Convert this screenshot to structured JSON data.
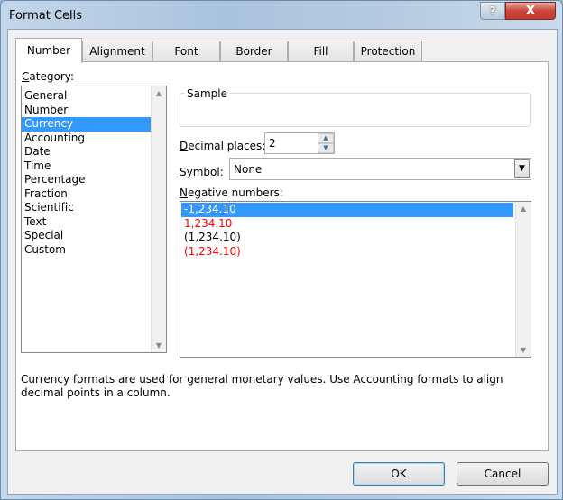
{
  "window": {
    "title": "Format Cells",
    "help_label": "?",
    "close_label": "X"
  },
  "tabs": [
    {
      "label": "Number"
    },
    {
      "label": "Alignment"
    },
    {
      "label": "Font"
    },
    {
      "label": "Border"
    },
    {
      "label": "Fill"
    },
    {
      "label": "Protection"
    }
  ],
  "category": {
    "label_u": "C",
    "label_rest": "ategory:",
    "items": [
      "General",
      "Number",
      "Currency",
      "Accounting",
      "Date",
      "Time",
      "Percentage",
      "Fraction",
      "Scientific",
      "Text",
      "Special",
      "Custom"
    ],
    "selected": "Currency"
  },
  "sample": {
    "label": "Sample",
    "value": ""
  },
  "decimal": {
    "label_u": "D",
    "label_rest": "ecimal places:",
    "value": "2"
  },
  "symbol": {
    "label_u": "S",
    "label_rest": "ymbol:",
    "value": "None"
  },
  "negative": {
    "label_u": "N",
    "label_rest": "egative numbers:",
    "items": [
      {
        "text": "-1,234.10",
        "color": "#000000",
        "selected": true
      },
      {
        "text": "1,234.10",
        "color": "#ff0000"
      },
      {
        "text": "(1,234.10)",
        "color": "#000000"
      },
      {
        "text": "(1,234.10)",
        "color": "#ff0000"
      }
    ]
  },
  "description": "Currency formats are used for general monetary values.  Use Accounting formats to align decimal points in a column.",
  "buttons": {
    "ok": "OK",
    "cancel": "Cancel"
  }
}
